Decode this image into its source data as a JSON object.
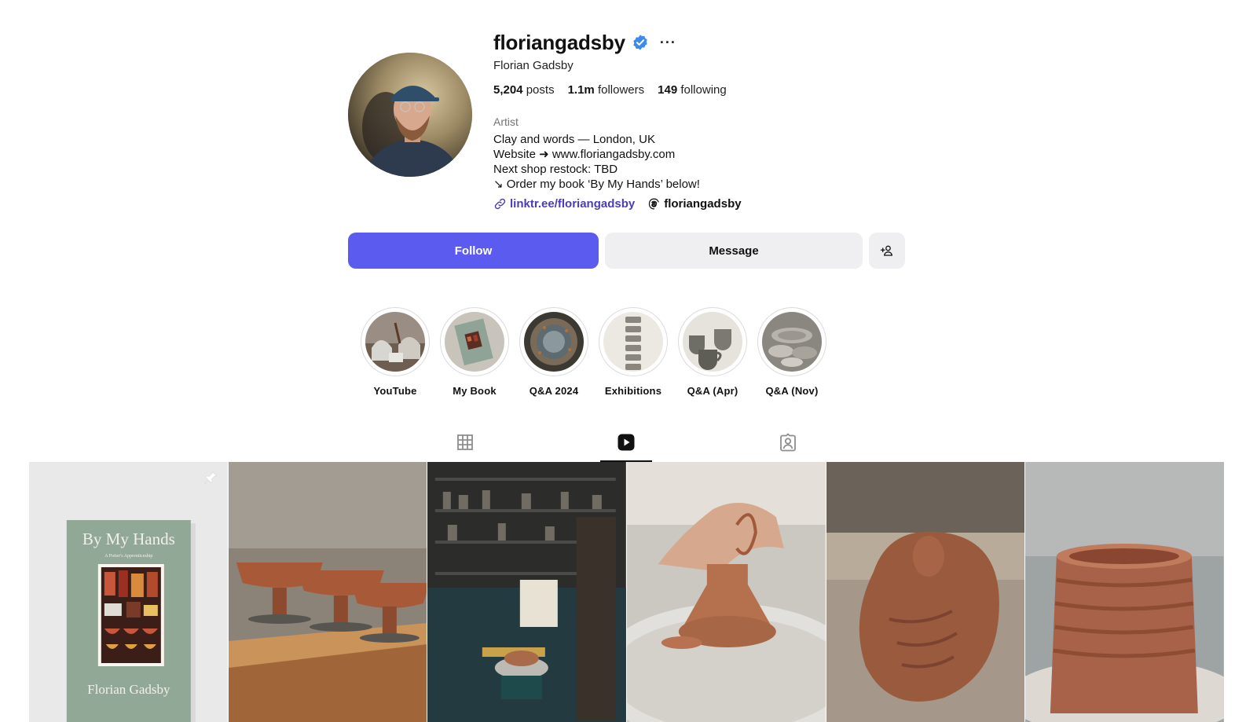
{
  "profile": {
    "username": "floriangadsby",
    "verified": true,
    "full_name": "Florian Gadsby",
    "stats": [
      {
        "value": "5,204",
        "label": "posts"
      },
      {
        "value": "1.1m",
        "label": "followers"
      },
      {
        "value": "149",
        "label": "following"
      }
    ],
    "category": "Artist",
    "bio_lines": [
      "Clay and words — London, UK",
      "Website ➜ www.floriangadsby.com",
      "Next shop restock: TBD",
      "↘ Order my book ‘By My Hands’ below!"
    ],
    "link_text": "linktr.ee/floriangadsby",
    "threads_handle": "floriangadsby"
  },
  "actions": {
    "follow_label": "Follow",
    "message_label": "Message"
  },
  "highlights": [
    {
      "label": "YouTube"
    },
    {
      "label": "My Book"
    },
    {
      "label": "Q&A 2024"
    },
    {
      "label": "Exhibitions"
    },
    {
      "label": "Q&A (Apr)"
    },
    {
      "label": "Q&A (Nov)"
    }
  ],
  "tabs": [
    {
      "name": "posts",
      "icon": "grid-icon",
      "active": false
    },
    {
      "name": "reels",
      "icon": "reels-icon",
      "active": true
    },
    {
      "name": "tagged",
      "icon": "tagged-icon",
      "active": false
    }
  ],
  "grid": {
    "pinned_book": {
      "title": "By My Hands",
      "subtitle": "A Potter's Apprenticeship",
      "author": "Florian Gadsby"
    }
  },
  "colors": {
    "accent": "#5b5bef",
    "link": "#4a3db8",
    "verified": "#3b8af0",
    "button_secondary": "#efeff2"
  }
}
